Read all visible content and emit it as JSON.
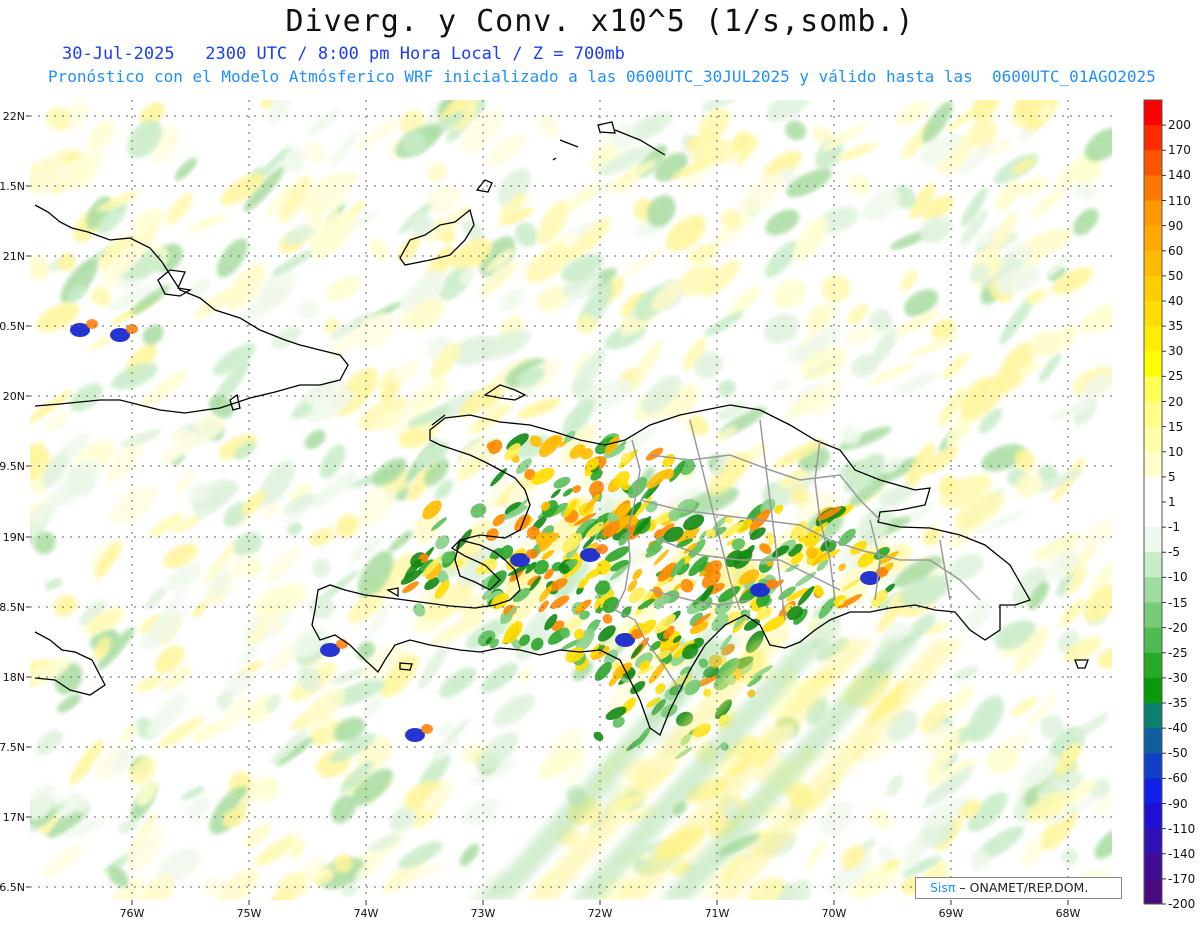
{
  "header": {
    "title": "Diverg. y Conv. x10^5 (1/s,somb.)",
    "valid_line": "30-Jul-2025   2300 UTC / 8:00 pm Hora Local / Z = 700mb",
    "model_line": "Pronóstico con el Modelo Atmósferico WRF inicializado a las 0600UTC_30JUL2025 y válido hasta las  0600UTC_01AGO2025"
  },
  "axes": {
    "lon_labels": [
      "76W",
      "75W",
      "74W",
      "73W",
      "72W",
      "71W",
      "70W",
      "69W",
      "68W"
    ],
    "lat_labels": [
      "22N",
      "1.5N",
      "21N",
      "0.5N",
      "20N",
      "9.5N",
      "19N",
      "8.5N",
      "18N",
      "7.5N",
      "17N",
      "6.5N"
    ]
  },
  "colorbar": {
    "labels": [
      "200",
      "170",
      "140",
      "110",
      "90",
      "60",
      "50",
      "40",
      "35",
      "30",
      "25",
      "20",
      "15",
      "10",
      "5",
      "1",
      "-1",
      "-5",
      "-10",
      "-15",
      "-20",
      "-25",
      "-30",
      "-35",
      "-40",
      "-50",
      "-60",
      "-90",
      "-110",
      "-140",
      "-170",
      "-200"
    ],
    "colors": [
      "#ff0000",
      "#ff2a00",
      "#ff5500",
      "#ff7700",
      "#ff9900",
      "#ffaa00",
      "#ffbb00",
      "#ffcc00",
      "#ffdd00",
      "#ffee00",
      "#ffff00",
      "#ffff55",
      "#ffff88",
      "#ffffaa",
      "#ffffcc",
      "#ffffff",
      "#ffffff",
      "#eef8ee",
      "#c8ecc8",
      "#a0dca0",
      "#78cc78",
      "#50bb50",
      "#28aa28",
      "#0a9a0a",
      "#0e8070",
      "#1060a0",
      "#1040c8",
      "#1020e6",
      "#2010d2",
      "#3010b4",
      "#400c96",
      "#4a0a80"
    ]
  },
  "credit": {
    "brand": "Sisπ",
    "text": " – ONAMET/REP.DOM."
  }
}
